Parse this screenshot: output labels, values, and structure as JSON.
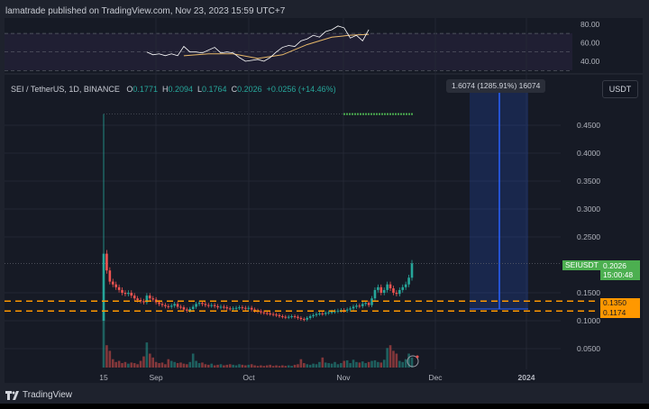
{
  "publisher": "lamatrade published on TradingView.com, Nov 23, 2023 15:59 UTC+7",
  "legend": {
    "symbol": "SEI / TetherUS, 1D, BINANCE",
    "o_label": "O",
    "o": "0.1771",
    "h_label": "H",
    "h": "0.2094",
    "l_label": "L",
    "l": "0.1764",
    "c_label": "C",
    "c": "0.2026",
    "change": "+0.0256 (+14.46%)"
  },
  "currency_button": "USDT",
  "measure_tooltip": "1.6074 (1285.91%) 16074",
  "symbol_tag": "SEIUSDT",
  "price_tag": "0.2026",
  "countdown": "15:00:48",
  "level_tags": [
    "0.1350",
    "0.1174"
  ],
  "footer": "TradingView",
  "colors": {
    "up": "#26a69a",
    "down": "#ef5350",
    "level": "#ff9800",
    "rsi": "#ffffff",
    "rsi_ma": "#e8b96a",
    "measure": "#2962ff"
  },
  "chart_data": {
    "type": "candlestick",
    "start_date": "2023-08-15",
    "price_axis": [
      "0.4500",
      "0.4000",
      "0.3500",
      "0.3000",
      "0.2500",
      "0.1500",
      "0.1000",
      "0.0500"
    ],
    "time_axis": [
      "15",
      "Sep",
      "Oct",
      "Nov",
      "Dec",
      "2024"
    ],
    "rsi_axis": [
      "80.00",
      "60.00",
      "40.00"
    ],
    "first_candle": {
      "open": 0.1,
      "high": 0.47,
      "low": 0.1
    },
    "closes": [
      0.22,
      0.19,
      0.17,
      0.165,
      0.16,
      0.155,
      0.15,
      0.148,
      0.15,
      0.145,
      0.14,
      0.137,
      0.135,
      0.133,
      0.145,
      0.14,
      0.138,
      0.133,
      0.13,
      0.128,
      0.126,
      0.125,
      0.127,
      0.13,
      0.125,
      0.124,
      0.12,
      0.118,
      0.121,
      0.125,
      0.13,
      0.132,
      0.13,
      0.128,
      0.127,
      0.128,
      0.126,
      0.124,
      0.125,
      0.124,
      0.122,
      0.121,
      0.122,
      0.123,
      0.124,
      0.123,
      0.122,
      0.123,
      0.12,
      0.118,
      0.117,
      0.115,
      0.114,
      0.113,
      0.112,
      0.111,
      0.11,
      0.108,
      0.107,
      0.106,
      0.107,
      0.108,
      0.107,
      0.105,
      0.103,
      0.102,
      0.105,
      0.108,
      0.11,
      0.112,
      0.113,
      0.112,
      0.114,
      0.115,
      0.116,
      0.117,
      0.118,
      0.119,
      0.118,
      0.12,
      0.122,
      0.125,
      0.127,
      0.126,
      0.13,
      0.132,
      0.128,
      0.14,
      0.155,
      0.16,
      0.15,
      0.155,
      0.165,
      0.158,
      0.15,
      0.148,
      0.155,
      0.16,
      0.165,
      0.177,
      0.2026
    ],
    "volumes": [
      100,
      40,
      30,
      15,
      10,
      12,
      8,
      10,
      7,
      9,
      8,
      6,
      12,
      20,
      45,
      25,
      18,
      10,
      8,
      9,
      6,
      15,
      12,
      10,
      8,
      9,
      7,
      6,
      10,
      25,
      12,
      8,
      9,
      6,
      5,
      7,
      4,
      5,
      6,
      4,
      5,
      6,
      5,
      4,
      6,
      5,
      4,
      5,
      6,
      4,
      3,
      4,
      3,
      4,
      5,
      3,
      4,
      3,
      4,
      3,
      4,
      3,
      5,
      6,
      15,
      8,
      6,
      5,
      7,
      6,
      10,
      18,
      9,
      8,
      7,
      10,
      6,
      8,
      12,
      13,
      8,
      14,
      10,
      9,
      11,
      8,
      10,
      12,
      13,
      10,
      9,
      14,
      35,
      40,
      30,
      25,
      12,
      10,
      15,
      25,
      18
    ],
    "rsi": [
      [
        14,
        50
      ],
      [
        16,
        47
      ],
      [
        18,
        48
      ],
      [
        20,
        46
      ],
      [
        22,
        48
      ],
      [
        24,
        46
      ],
      [
        26,
        56
      ],
      [
        28,
        50
      ],
      [
        30,
        50
      ],
      [
        32,
        49
      ],
      [
        34,
        52
      ],
      [
        36,
        55
      ],
      [
        38,
        49
      ],
      [
        40,
        50
      ],
      [
        42,
        49
      ],
      [
        44,
        44
      ],
      [
        46,
        40
      ],
      [
        48,
        41
      ],
      [
        50,
        42
      ],
      [
        52,
        40
      ],
      [
        54,
        44
      ],
      [
        56,
        50
      ],
      [
        58,
        55
      ],
      [
        60,
        57
      ],
      [
        62,
        56
      ],
      [
        64,
        62
      ],
      [
        66,
        64
      ],
      [
        68,
        68
      ],
      [
        70,
        66
      ],
      [
        72,
        72
      ],
      [
        74,
        74
      ],
      [
        76,
        78
      ],
      [
        78,
        76
      ],
      [
        80,
        65
      ],
      [
        82,
        68
      ],
      [
        84,
        62
      ],
      [
        86,
        74
      ]
    ],
    "rsi_ma": [
      [
        26,
        46
      ],
      [
        34,
        48
      ],
      [
        42,
        48
      ],
      [
        50,
        43
      ],
      [
        58,
        47
      ],
      [
        66,
        58
      ],
      [
        74,
        66
      ],
      [
        80,
        68
      ],
      [
        86,
        69
      ]
    ],
    "rsi_band": [
      30,
      70
    ],
    "levels": [
      0.135,
      0.1174
    ],
    "last_price": 0.2026
  }
}
